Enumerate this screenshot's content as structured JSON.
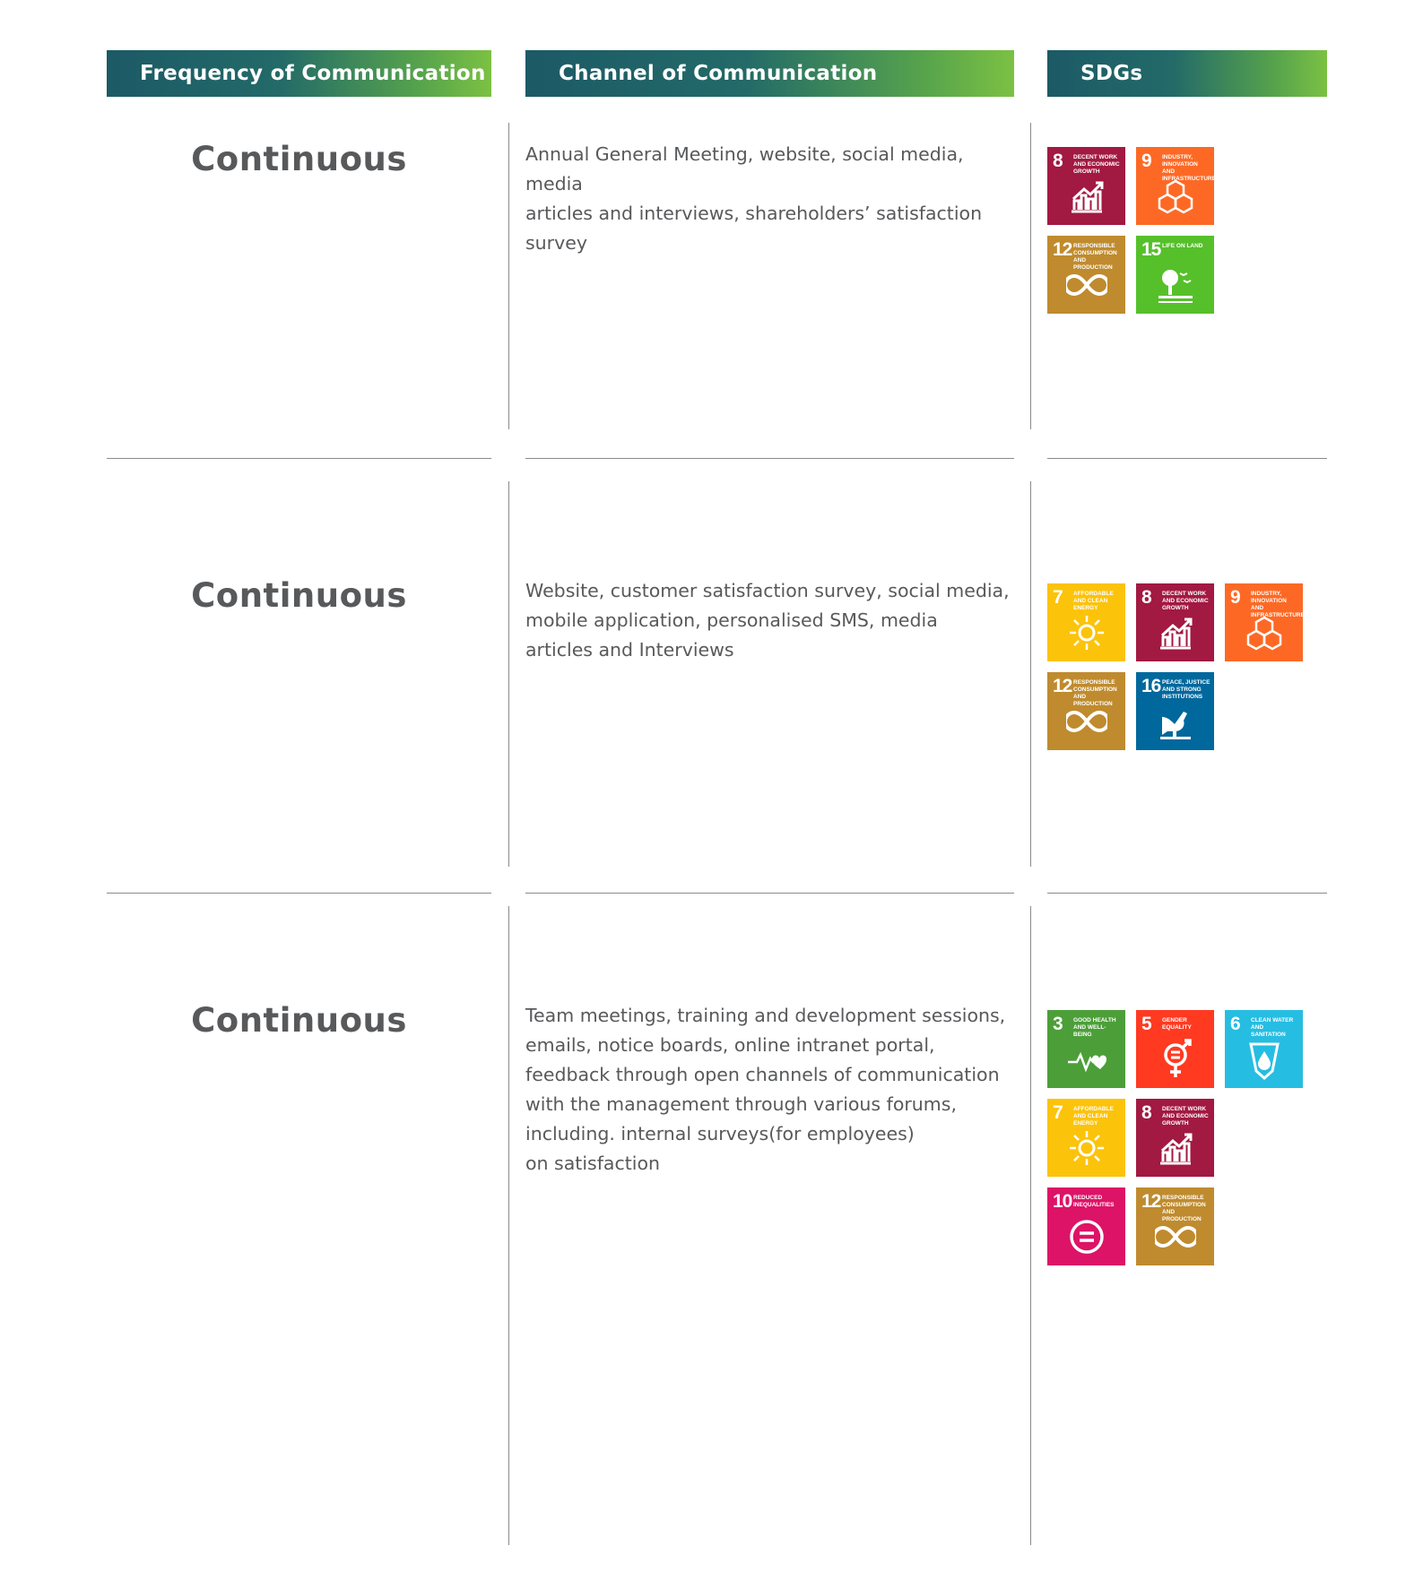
{
  "headers": {
    "frequency": "Frequency of Communication",
    "channel": "Channel of Communication",
    "sdgs": "SDGs"
  },
  "rows": [
    {
      "frequency": "Continuous",
      "channel": "Annual General Meeting, website, social media, media\narticles and interviews, shareholders’ satisfaction survey",
      "sdgs": [
        {
          "num": "8",
          "title": "Decent work and economic growth",
          "color": "#a21942",
          "icon": "growth-chart-icon"
        },
        {
          "num": "9",
          "title": "Industry, innovation and infrastructure",
          "color": "#fd6925",
          "icon": "cubes-icon"
        },
        {
          "num": "12",
          "title": "Responsible consumption and production",
          "color": "#bf8b2e",
          "icon": "infinity-icon"
        },
        {
          "num": "15",
          "title": "Life on land",
          "color": "#56c02b",
          "icon": "tree-icon"
        }
      ]
    },
    {
      "frequency": "Continuous",
      "channel": "Website, customer satisfaction survey, social media,\nmobile application, personalised SMS, media\narticles and Interviews",
      "sdgs": [
        {
          "num": "7",
          "title": "Affordable and clean energy",
          "color": "#fcc30b",
          "icon": "sun-icon"
        },
        {
          "num": "8",
          "title": "Decent work and economic growth",
          "color": "#a21942",
          "icon": "growth-chart-icon"
        },
        {
          "num": "9",
          "title": "Industry, innovation and infrastructure",
          "color": "#fd6925",
          "icon": "cubes-icon"
        },
        {
          "num": "12",
          "title": "Responsible consumption and production",
          "color": "#bf8b2e",
          "icon": "infinity-icon"
        },
        {
          "num": "16",
          "title": "Peace, justice and strong institutions",
          "color": "#00689d",
          "icon": "dove-icon"
        }
      ]
    },
    {
      "frequency": "Continuous",
      "channel": "Team meetings, training and development sessions,\nemails, notice boards, online intranet portal,\nfeedback through open channels of communication\nwith the management through various  forums,\nincluding. internal surveys(for employees)\non satisfaction",
      "sdgs": [
        {
          "num": "3",
          "title": "Good health and well-being",
          "color": "#4c9f38",
          "icon": "heartbeat-icon"
        },
        {
          "num": "5",
          "title": "Gender equality",
          "color": "#ff3a21",
          "icon": "gender-icon"
        },
        {
          "num": "6",
          "title": "Clean water and sanitation",
          "color": "#26bde2",
          "icon": "water-drop-icon"
        },
        {
          "num": "7",
          "title": "Affordable and clean energy",
          "color": "#fcc30b",
          "icon": "sun-icon"
        },
        {
          "num": "8",
          "title": "Decent work and economic growth",
          "color": "#a21942",
          "icon": "growth-chart-icon"
        },
        {
          "num": "10",
          "title": "Reduced inequalities",
          "color": "#dd1367",
          "icon": "equality-icon"
        },
        {
          "num": "12",
          "title": "Responsible consumption and production",
          "color": "#bf8b2e",
          "icon": "infinity-icon"
        }
      ]
    }
  ]
}
